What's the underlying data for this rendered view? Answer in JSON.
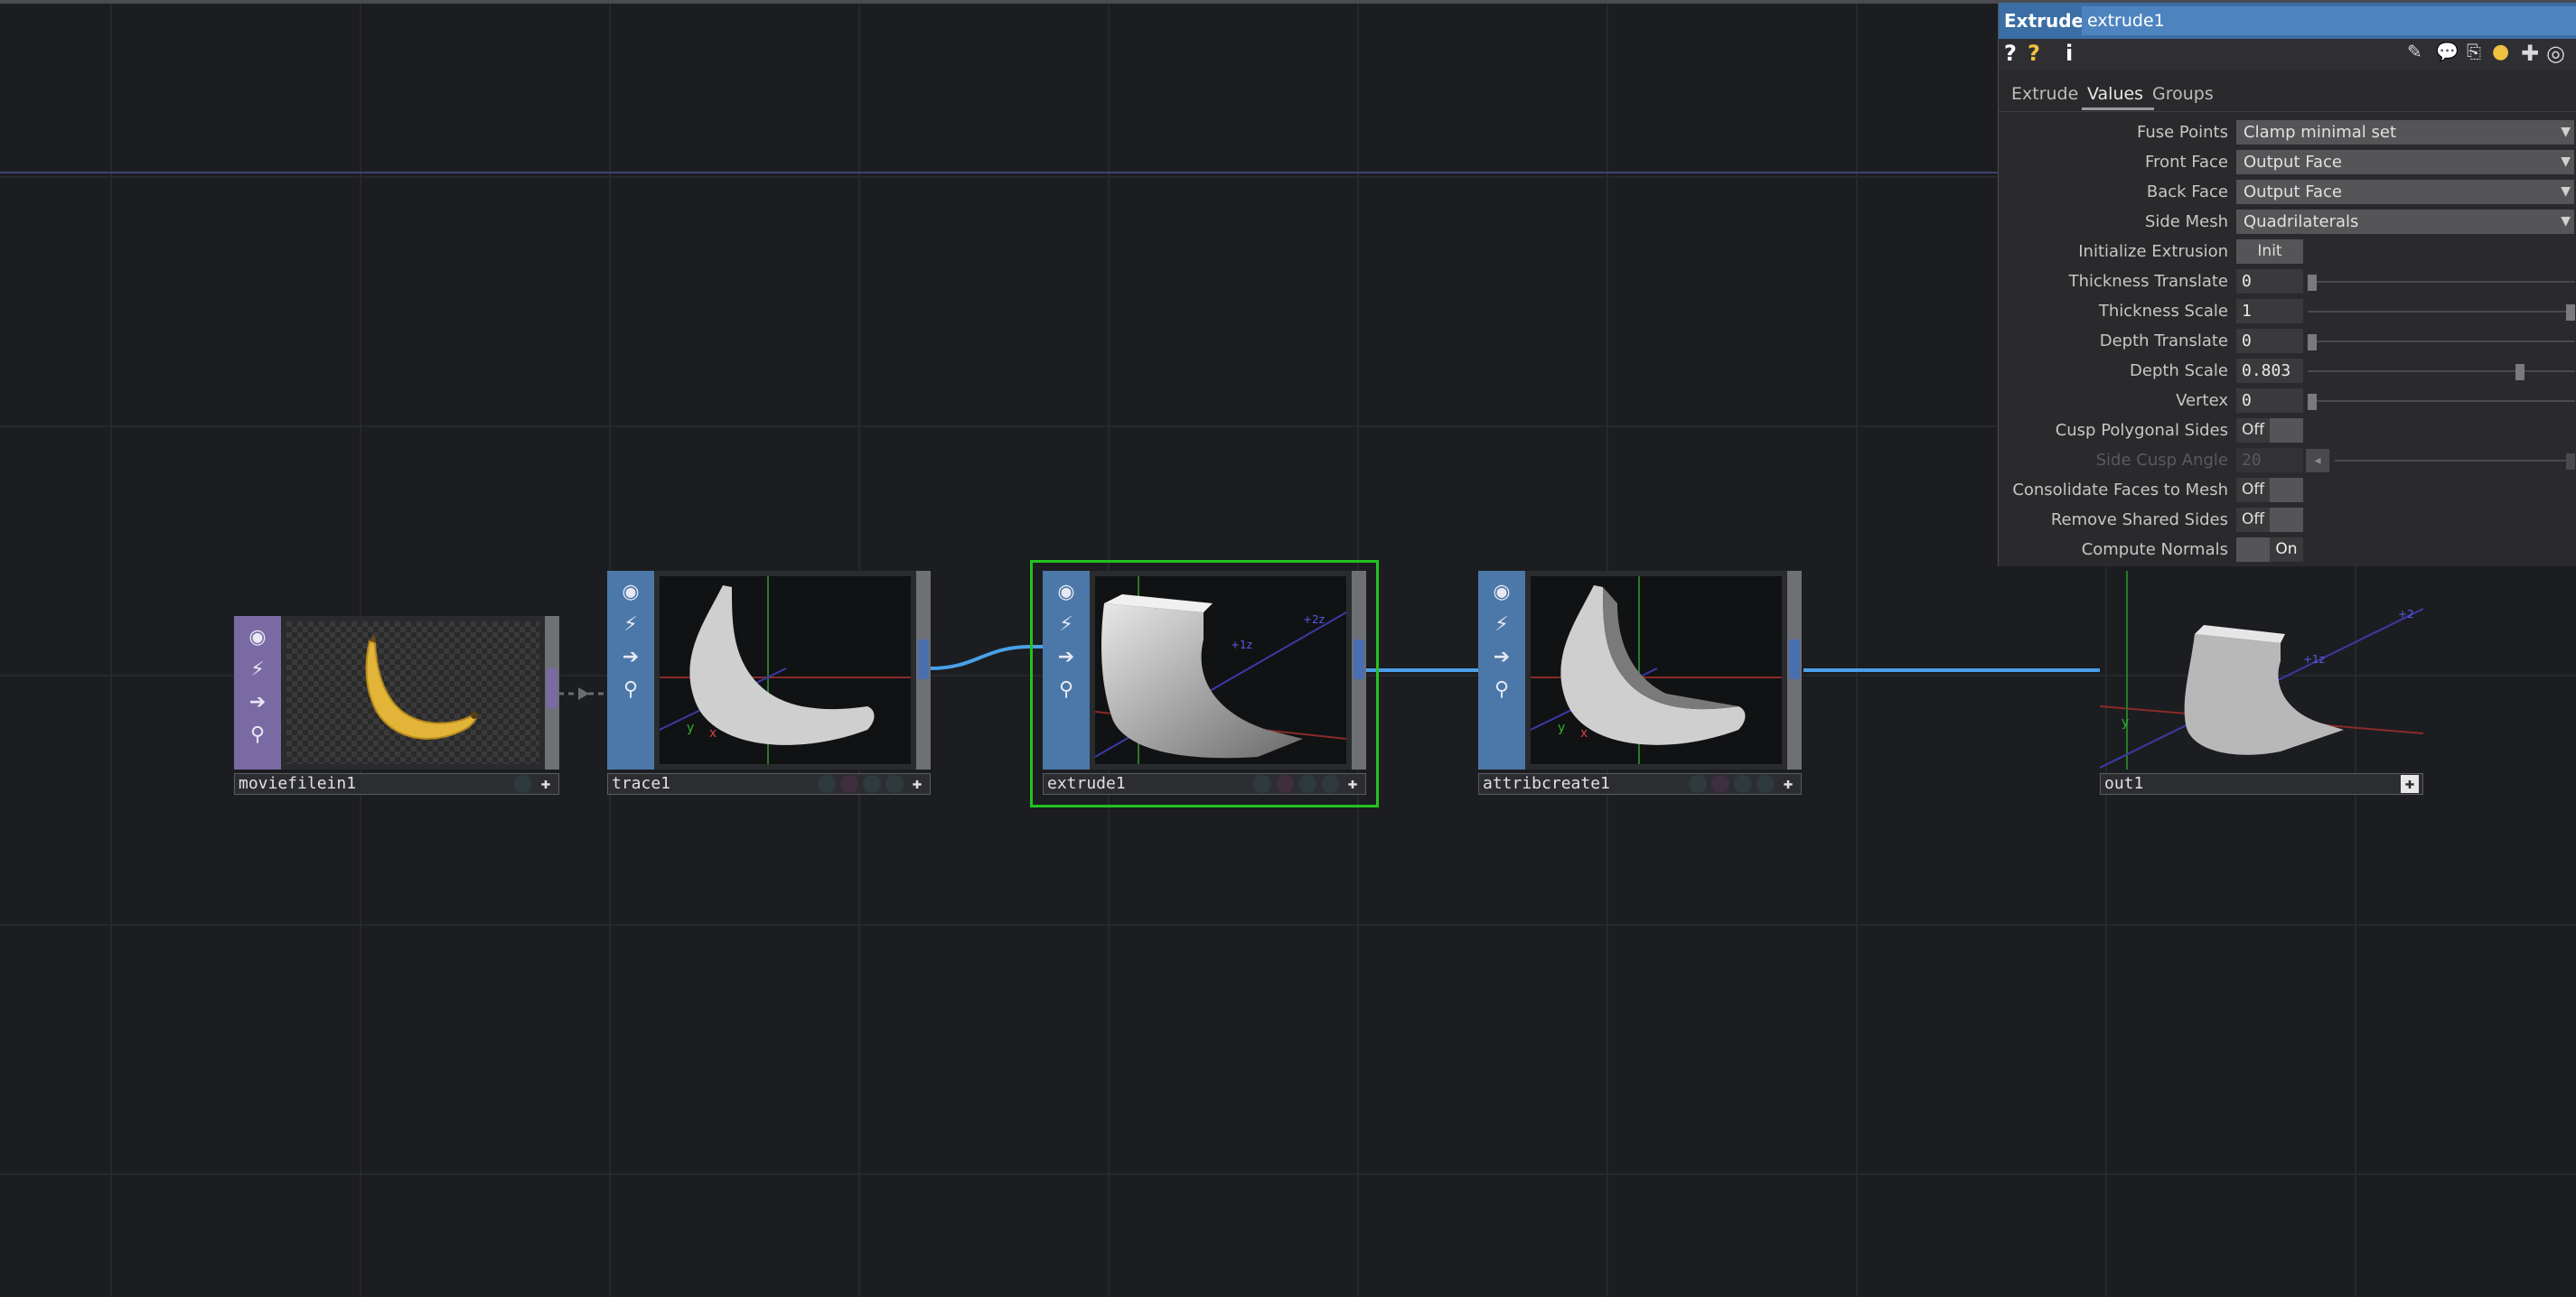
{
  "panel": {
    "type": "Extrude",
    "name": "extrude1",
    "tabs": [
      "Extrude",
      "Values",
      "Groups"
    ],
    "active_tab": "Values",
    "toolbar_left": [
      "?",
      "?",
      "i"
    ],
    "params": {
      "fuse_points": {
        "label": "Fuse Points",
        "value": "Clamp minimal set"
      },
      "front_face": {
        "label": "Front Face",
        "value": "Output Face"
      },
      "back_face": {
        "label": "Back Face",
        "value": "Output Face"
      },
      "side_mesh": {
        "label": "Side Mesh",
        "value": "Quadrilaterals"
      },
      "initialize_extrusion": {
        "label": "Initialize Extrusion",
        "button": "Init"
      },
      "thickness_translate": {
        "label": "Thickness Translate",
        "value": "0",
        "level": 0.0
      },
      "thickness_scale": {
        "label": "Thickness Scale",
        "value": "1",
        "level": 1.0
      },
      "depth_translate": {
        "label": "Depth Translate",
        "value": "0",
        "level": 0.0
      },
      "depth_scale": {
        "label": "Depth Scale",
        "value": "0.803",
        "level": 0.803
      },
      "vertex": {
        "label": "Vertex",
        "value": "0",
        "level": 0.0
      },
      "cusp_polygonal_sides": {
        "label": "Cusp Polygonal Sides",
        "value": "Off"
      },
      "side_cusp_angle": {
        "label": "Side Cusp Angle",
        "value": "20"
      },
      "consolidate_faces": {
        "label": "Consolidate Faces to Mesh",
        "value": "Off"
      },
      "remove_shared_sides": {
        "label": "Remove Shared Sides",
        "value": "Off"
      },
      "compute_normals": {
        "label": "Compute Normals",
        "value": "On"
      }
    }
  },
  "nodes": [
    {
      "name": "moviefilein1"
    },
    {
      "name": "trace1"
    },
    {
      "name": "extrude1"
    },
    {
      "name": "attribcreate1"
    },
    {
      "name": "out1"
    }
  ],
  "colors": {
    "selected": "#23c21f",
    "top_family": "#7a6aa3",
    "sop_family": "#4b78a8",
    "wire": "#4aa0e8"
  }
}
